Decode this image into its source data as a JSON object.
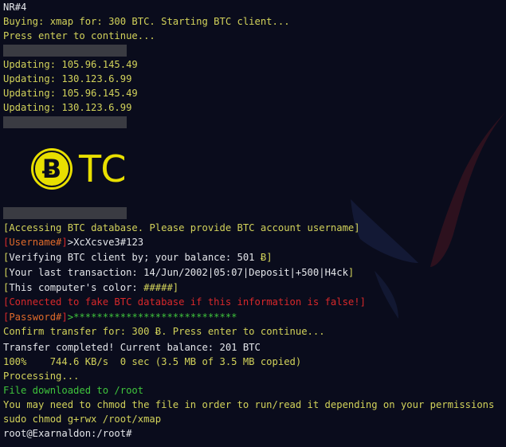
{
  "terminal": {
    "lines": {
      "l1": "NR#4",
      "l2": "Buying: xmap for: 300 BTC. Starting BTC client...",
      "l3": "Press enter to continue...",
      "u1": "Updating: 105.96.145.49",
      "u2": "Updating: 130.123.6.99",
      "u3": "Updating: 105.96.145.49",
      "u4": "Updating: 130.123.6.99",
      "access_text": "Accessing BTC database. Please provide BTC account username",
      "username_label": "Username#",
      "username_value": ">XcXcsve3#123",
      "verify_text": "Verifying BTC client by; your balance: 501 ",
      "verify_symbol": "Ƀ",
      "last_tx_text": "Your last transaction: 14/Jun/2002|05:07|Deposit|+500|H4ck",
      "color_text": "This computer's color: ",
      "color_value": "#####",
      "warning_text": "Connected to fake BTC database if this information is false!",
      "password_label": "Password#",
      "password_value": ">****************************",
      "confirm_text_a": "Confirm transfer for: 300 ",
      "confirm_symbol": "Ƀ",
      "confirm_text_b": ". Press enter to continue...",
      "transfer_done": "Transfer completed! Current balance: 201 BTC",
      "progress": "100%    744.6 KB/s  0 sec (3.5 MB of 3.5 MB copied)",
      "processing": "Processing...",
      "downloaded": "File downloaded to /root",
      "chmod_note": "You may need to chmod the file in order to run/read it depending on your permissions",
      "chmod_cmd": "sudo chmod g+rwx /root/xmap",
      "prompt": "root@Exarnaldon:/root#"
    },
    "brackets": {
      "open": "[",
      "close": "]"
    },
    "logo": {
      "text": "TC",
      "coin_symbol": "Ƀ"
    },
    "colors": {
      "background": "#0a0c1c",
      "yellow": "#d2d25a",
      "white": "#e4e6ea",
      "green": "#3fc43c",
      "red": "#d8282a",
      "orange": "#e06a2a",
      "logo_yellow": "#e8df00",
      "separator": "#3a3b42"
    }
  }
}
